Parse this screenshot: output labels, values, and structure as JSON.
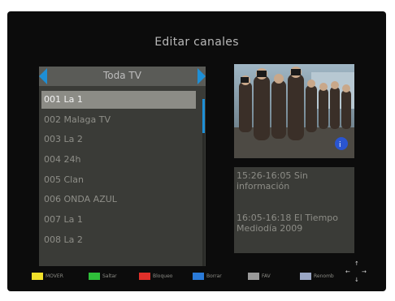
{
  "screen": {
    "title": "Editar canales"
  },
  "group": {
    "label": "Toda TV"
  },
  "channels": [
    {
      "label": "001 La 1",
      "selected": true
    },
    {
      "label": "002 Malaga TV",
      "selected": false
    },
    {
      "label": "003 La 2",
      "selected": false
    },
    {
      "label": "004 24h",
      "selected": false
    },
    {
      "label": "005 Clan",
      "selected": false
    },
    {
      "label": "006 ONDA AZUL",
      "selected": false
    },
    {
      "label": "007 La 1",
      "selected": false
    },
    {
      "label": "008 La 2",
      "selected": false
    }
  ],
  "info": {
    "events": [
      {
        "text": "15:26-16:05  Sin información"
      },
      {
        "text": "16:05-16:18  El Tiempo Mediodía 2009"
      }
    ]
  },
  "legend": {
    "keys": [
      {
        "label": "MOVER",
        "color": "#f0e02a"
      },
      {
        "label": "Saltar",
        "color": "#2fbf3a"
      },
      {
        "label": "Bloqueo",
        "color": "#e0302a"
      },
      {
        "label": "Borrar",
        "color": "#2a7ad8"
      },
      {
        "label": "FAV",
        "color": "#9a9a9a",
        "badge": "FAV"
      },
      {
        "label": "Renomb",
        "color": "#9aa6c4",
        "badge": "INFO"
      }
    ]
  },
  "colors": {
    "accent": "#1e8fd6",
    "panel": "#3a3b37",
    "selected": "#8c8c86",
    "background": "#0c0c0c"
  },
  "icons": {
    "group_left": "chevron-left-icon",
    "group_right": "chevron-right-icon",
    "navigation": "dpad-arrows-icon"
  }
}
